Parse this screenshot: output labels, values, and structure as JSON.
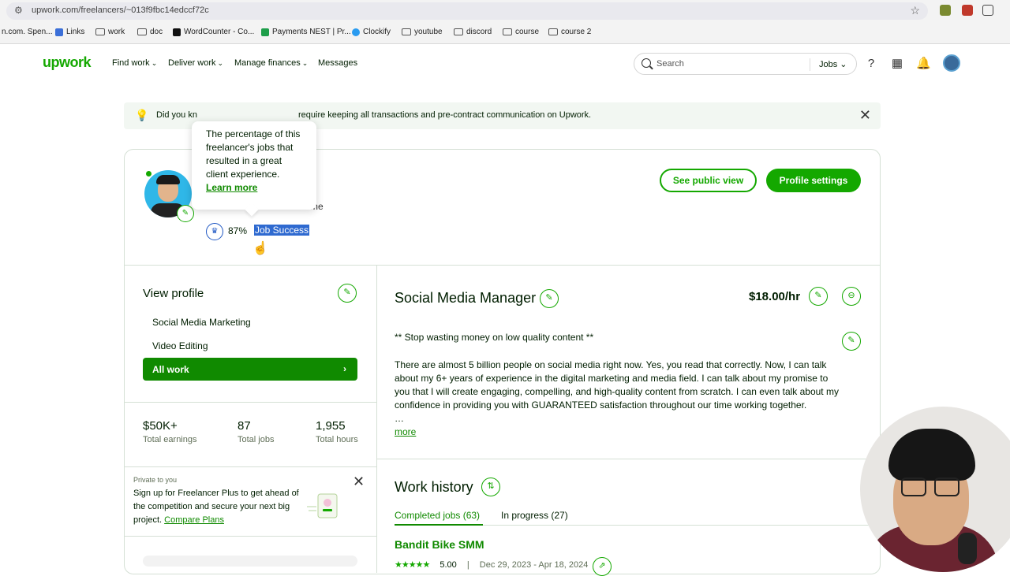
{
  "browser": {
    "url": "upwork.com/freelancers/~013f9fbc14edccf72c",
    "bookmarks": [
      "n.com. Spen...",
      "Links",
      "work",
      "doc",
      "WordCounter - Co...",
      "Payments NEST | Pr...",
      "Clockify",
      "youtube",
      "discord",
      "course",
      "course 2"
    ]
  },
  "nav": {
    "logo": "upwork",
    "links": [
      "Find work",
      "Deliver work",
      "Manage finances",
      "Messages"
    ],
    "search_placeholder": "Search",
    "search_scope": "Jobs"
  },
  "notice": {
    "text": "Did you kn ... require keeping all transactions and pre-contract communication on Upwork.",
    "text_left": "Did you kn",
    "text_right": "require keeping all transactions and pre-contract communication on Upwork."
  },
  "profile": {
    "location": "local time",
    "job_success_pct": "87%",
    "job_success_label": "Job Success",
    "tooltip": "The percentage of this freelancer's jobs that resulted in a great client experience.",
    "tooltip_link": "Learn more",
    "see_public": "See public view",
    "settings": "Profile settings"
  },
  "sidebar": {
    "title": "View profile",
    "items": [
      "Social Media Marketing",
      "Video Editing"
    ],
    "all_work": "All work",
    "stats": [
      {
        "value": "$50K+",
        "label": "Total earnings"
      },
      {
        "value": "87",
        "label": "Total jobs"
      },
      {
        "value": "1,955",
        "label": "Total hours"
      }
    ],
    "promo_kicker": "Private to you",
    "promo_text": "Sign up for Freelancer Plus to get ahead of the competition and secure your next big project.",
    "promo_link": "Compare Plans"
  },
  "main": {
    "title": "Social Media Manager",
    "rate": "$18.00/hr",
    "quote": "** Stop wasting money on low quality content **",
    "description": "There are almost 5 billion people on social media right now. Yes, you read that correctly. Now, I can talk about my 6+ years of experience in the digital marketing and media field. I can talk about my promise to you that I will create engaging, compelling, and high-quality content from scratch. I can even talk about my confidence in providing you with GUARANTEED satisfaction throughout our time working together.",
    "more": "more",
    "work_history": "Work history",
    "tabs": [
      "Completed jobs (63)",
      "In progress (27)"
    ],
    "job_title": "Bandit Bike SMM",
    "job_rating": "5.00",
    "job_dates": "Dec 29, 2023 - Apr 18, 2024"
  }
}
